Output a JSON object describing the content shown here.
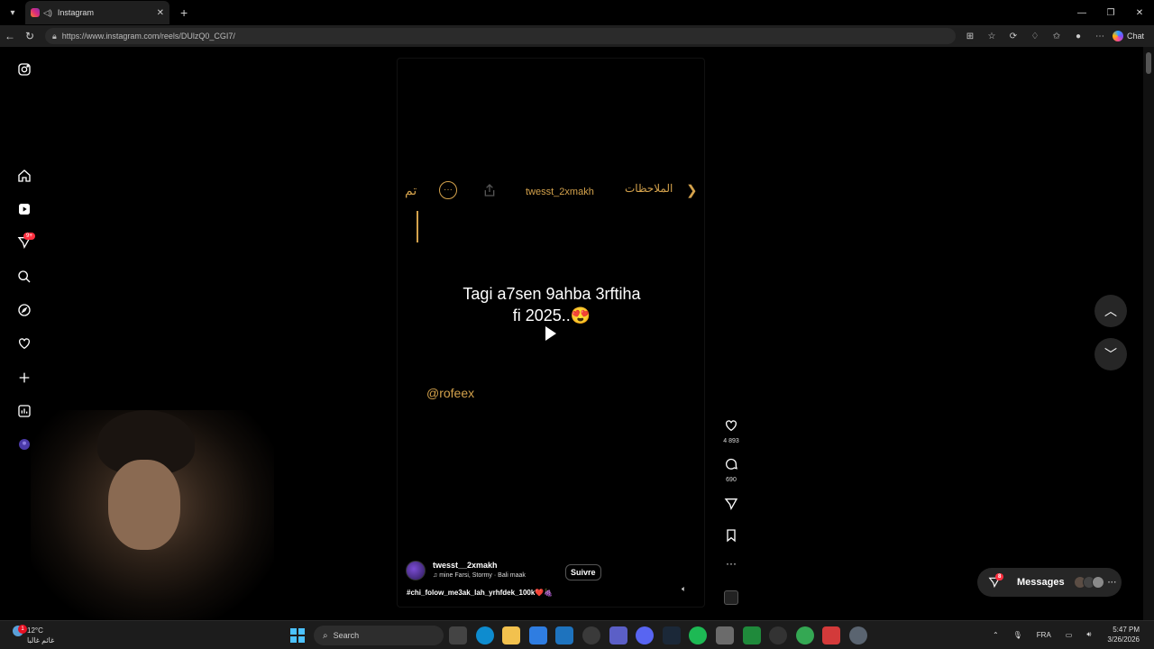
{
  "browser": {
    "tab_title": "Instagram",
    "url": "https://www.instagram.com/reels/DUlzQ0_CGI7/",
    "chat_label": "Chat"
  },
  "sidebar": {
    "notifications_badge": "9+"
  },
  "reel": {
    "header": {
      "done_label": "تم",
      "username": "twesst_2xmakh",
      "notes_label": "الملاحظات"
    },
    "caption_line1": "Tagi a7sen 9ahba 3rftiha",
    "caption_line2": "fi 2025..😍",
    "mention": "@rofeex",
    "author": "twesst__2xmakh",
    "song": "mine Farsi, Stormy · Bali maak",
    "follow_label": "Suivre",
    "hashtags": "#chi_folow_me3ak_lah_yrhfdek_100k❤️🍇",
    "likes": "4 893",
    "comments": "690"
  },
  "messages": {
    "label": "Messages",
    "badge": "8"
  },
  "taskbar": {
    "weather_temp": "12°C",
    "weather_desc": "غائم غالبا",
    "weather_badge": "1",
    "search_placeholder": "Search",
    "lang": "FRA",
    "time": "5:47 PM",
    "date": "3/26/2026"
  },
  "colors": {
    "accent_gold": "#d4a24c",
    "badge_red": "#ff3040",
    "windows_blue": "#4cc2ff"
  }
}
